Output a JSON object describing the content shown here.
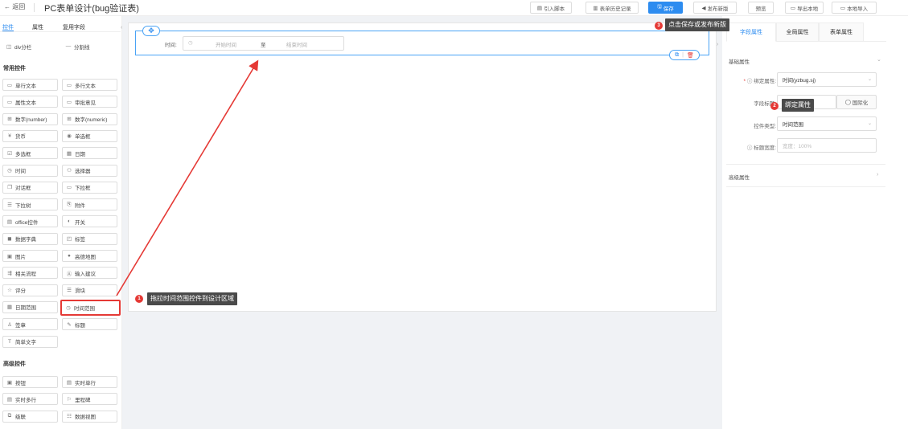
{
  "topbar": {
    "back_label": "← 返回",
    "title": "PC表单设计(bug验证表)",
    "buttons": [
      {
        "icon": "▤",
        "label": "引入脚本"
      },
      {
        "icon": "▥",
        "label": "表单历史记录"
      },
      {
        "icon": "🖫",
        "label": "保存"
      },
      {
        "icon": "◀",
        "label": "发布新版"
      },
      {
        "icon": "",
        "label": "预览"
      },
      {
        "icon": "▭",
        "label": "导出本地"
      },
      {
        "icon": "▭",
        "label": "本地导入"
      }
    ]
  },
  "left_panel": {
    "tabs": [
      "控件",
      "属性",
      "复用字段"
    ],
    "top_items": [
      {
        "icon": "◫",
        "label": "div分栏"
      },
      {
        "icon": "—",
        "label": "分割线"
      }
    ],
    "group_common": "常用控件",
    "common_items": [
      {
        "icon": "▭",
        "label": "单行文本"
      },
      {
        "icon": "▭",
        "label": "多行文本"
      },
      {
        "icon": "▭",
        "label": "属性文本"
      },
      {
        "icon": "▭",
        "label": "审批意见"
      },
      {
        "icon": "⊞",
        "label": "数字(number)"
      },
      {
        "icon": "⊞",
        "label": "数字(numeric)"
      },
      {
        "icon": "¥",
        "label": "货币"
      },
      {
        "icon": "◉",
        "label": "单选框"
      },
      {
        "icon": "☑",
        "label": "多选框"
      },
      {
        "icon": "▦",
        "label": "日期"
      },
      {
        "icon": "◷",
        "label": "时间"
      },
      {
        "icon": "⚇",
        "label": "选择器"
      },
      {
        "icon": "❐",
        "label": "对话框"
      },
      {
        "icon": "▭",
        "label": "下拉框"
      },
      {
        "icon": "☰",
        "label": "下拉树"
      },
      {
        "icon": "⎘",
        "label": "附件"
      },
      {
        "icon": "▤",
        "label": "office控件"
      },
      {
        "icon": "◐",
        "label": "开关"
      },
      {
        "icon": "◼",
        "label": "数据字典"
      },
      {
        "icon": "◰",
        "label": "标签"
      },
      {
        "icon": "▣",
        "label": "图片"
      },
      {
        "icon": "●",
        "label": "高德地图"
      },
      {
        "icon": "⇶",
        "label": "相关流程"
      },
      {
        "icon": "Ⓐ",
        "label": "输入建议"
      },
      {
        "icon": "☆",
        "label": "评分"
      },
      {
        "icon": "☰",
        "label": "滑块"
      },
      {
        "icon": "▦",
        "label": "日期范围"
      },
      {
        "icon": "◷",
        "label": "时间范围"
      },
      {
        "icon": "♙",
        "label": "签章"
      },
      {
        "icon": "✎",
        "label": "标题"
      },
      {
        "icon": "T",
        "label": "简单文字"
      }
    ],
    "group_advanced": "高级控件",
    "advanced_items": [
      {
        "icon": "▣",
        "label": "按钮"
      },
      {
        "icon": "▤",
        "label": "实时单行"
      },
      {
        "icon": "▤",
        "label": "实时多行"
      },
      {
        "icon": "⚐",
        "label": "里程碑"
      },
      {
        "icon": "⧉",
        "label": "级联"
      },
      {
        "icon": "☷",
        "label": "数据视图"
      }
    ]
  },
  "canvas": {
    "field_label": "时间:",
    "start_placeholder": "开始时间",
    "to_label": "至",
    "end_placeholder": "结束时间"
  },
  "right_panel": {
    "tabs": [
      "字段属性",
      "全局属性",
      "表单属性"
    ],
    "basic_section": "基础属性",
    "bind_label": "绑定属性:",
    "bind_value": "时间(yzbug.sj)",
    "title_label": "字段标题:",
    "title_value": "时间",
    "i18n_label": "国际化",
    "type_label": "控件类型:",
    "type_value": "时间范围",
    "width_label": "标题宽度:",
    "width_placeholder": "宽度：100%",
    "advanced_section": "高级属性"
  },
  "annotations": [
    {
      "num": "1",
      "text": "拖拉时间范围控件到设计区域"
    },
    {
      "num": "2",
      "text": "绑定属性"
    },
    {
      "num": "3",
      "text": "点击保存或发布新版"
    }
  ],
  "colors": {
    "accent": "#2d8cf0",
    "annotation": "#e53935",
    "tooltip_bg": "#4a4a4a"
  }
}
